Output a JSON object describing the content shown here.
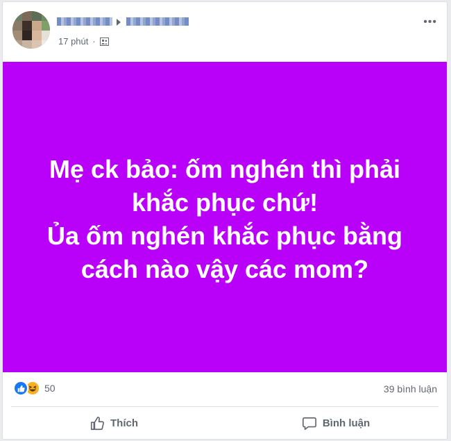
{
  "post": {
    "time": "17 phút",
    "separator": "·",
    "privacy_icon": "friends-icon",
    "more_icon": "more-icon",
    "image_text_lines": [
      "Mẹ ck bảo: ốm nghén thì phải",
      "khắc phục chứ!",
      "Ủa ốm nghén khắc phục bằng",
      "cách nào vậy các mom?"
    ],
    "image_background": "#b900f9"
  },
  "stats": {
    "reaction_icons": [
      "like-icon",
      "haha-icon"
    ],
    "reaction_count": "50",
    "comments": "39 bình luận"
  },
  "actions": {
    "like_label": "Thích",
    "comment_label": "Bình luận"
  }
}
